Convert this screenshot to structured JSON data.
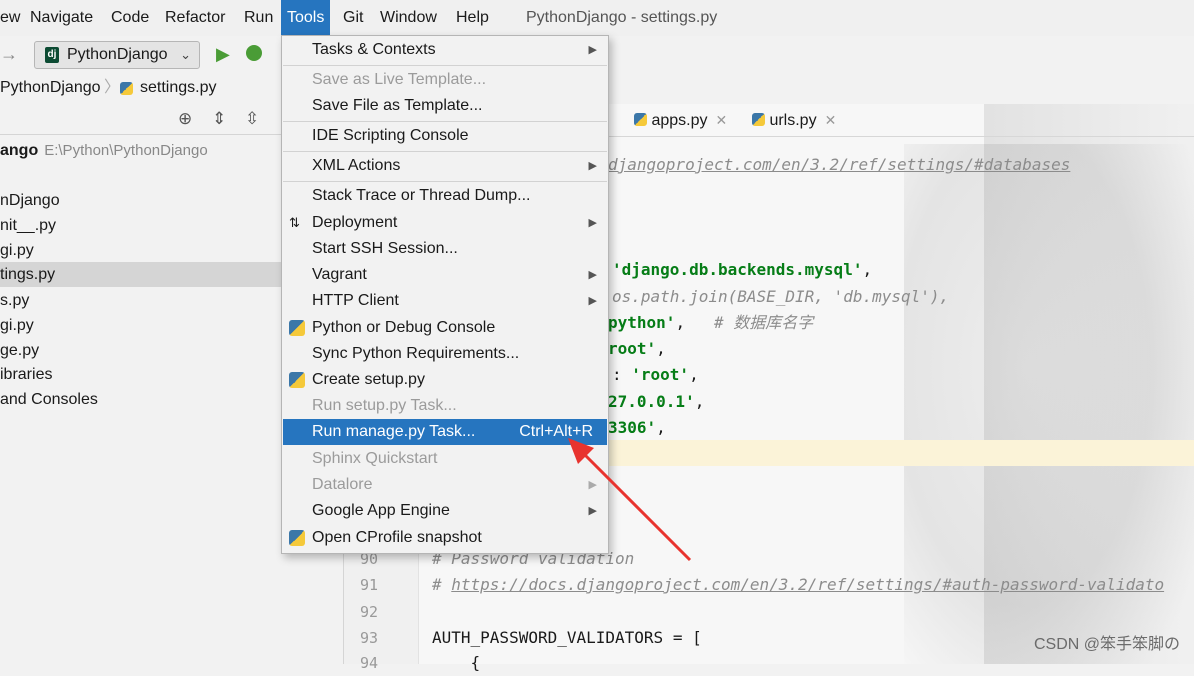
{
  "menubar": {
    "items": [
      "ew",
      "Navigate",
      "Code",
      "Refactor",
      "Run",
      "Tools",
      "Git",
      "Window",
      "Help"
    ],
    "window_title": "PythonDjango - settings.py"
  },
  "toolbar": {
    "run_config": "PythonDjango"
  },
  "breadcrumb": {
    "project": "PythonDjango",
    "file": "settings.py"
  },
  "project_tree": {
    "root_name": "ango",
    "root_path": "E:\\Python\\PythonDjango",
    "rows": [
      "nDjango",
      "nit__.py",
      "gi.py",
      "tings.py",
      "s.py",
      "gi.py",
      "ge.py",
      "ibraries",
      "and Consoles"
    ]
  },
  "editor": {
    "tabs": [
      "apps.py",
      "urls.py"
    ],
    "lines": {
      "l1_link": "djangoproject.com/en/3.2/ref/settings/#databases",
      "l2_str": "'django.db.backends.mysql'",
      "l2_tail": ",",
      "l3_cmt": "os.path.join(BASE_DIR, 'db.mysql'),",
      "l4_str": "python'",
      "l4_cmt": "# 数据库名字",
      "l5_str": "root'",
      "l6_pre": ": ",
      "l6_str": "'root'",
      "l7_str": "27.0.0.1'",
      "l8_str": "3306'",
      "n90": "90",
      "c90": "# Password validation",
      "n91": "91",
      "c91_hash": "# ",
      "c91_link": "https://docs.djangoproject.com/en/3.2/ref/settings/#auth-password-validato",
      "n92": "92",
      "n93": "93",
      "c93": "AUTH_PASSWORD_VALIDATORS = [",
      "n94": "94",
      "c94": "    {"
    }
  },
  "tools_menu": {
    "tasks": "Tasks & Contexts",
    "save_live": "Save as Live Template...",
    "save_file": "Save File as Template...",
    "ide_console": "IDE Scripting Console",
    "xml": "XML Actions",
    "stack": "Stack Trace or Thread Dump...",
    "deployment": "Deployment",
    "ssh": "Start SSH Session...",
    "vagrant": "Vagrant",
    "http": "HTTP Client",
    "python_console": "Python or Debug Console",
    "sync_req": "Sync Python Requirements...",
    "create_setup": "Create setup.py",
    "run_setup": "Run setup.py Task...",
    "run_manage": "Run manage.py Task...",
    "run_manage_shortcut": "Ctrl+Alt+R",
    "sphinx": "Sphinx Quickstart",
    "datalore": "Datalore",
    "gae": "Google App Engine",
    "cprofile": "Open CProfile snapshot"
  },
  "watermark": "CSDN @笨手笨脚の",
  "colors": {
    "accent": "#2675bf",
    "annotation_arrow": "#e8332e",
    "string": "#067d17"
  }
}
